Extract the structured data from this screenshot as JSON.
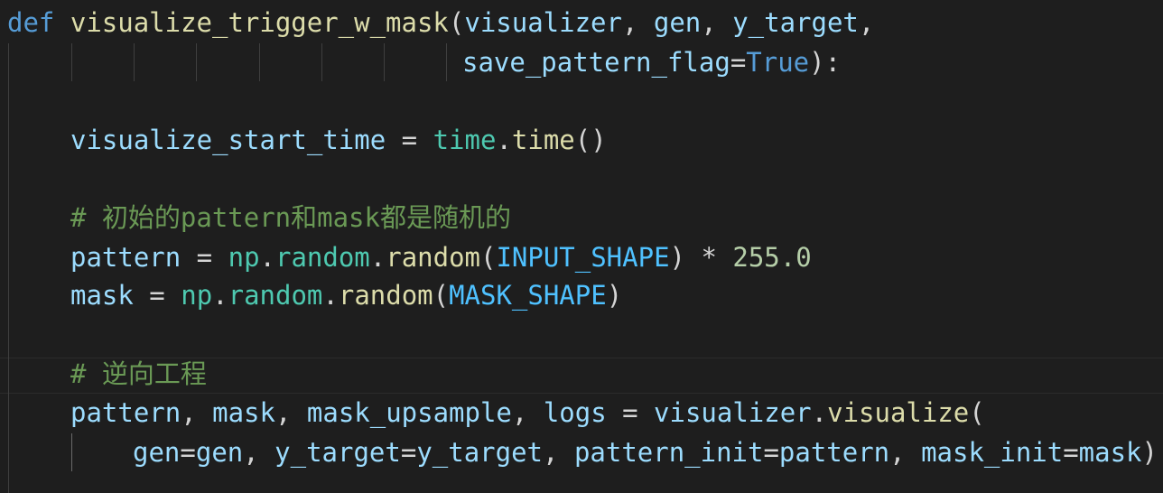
{
  "code": {
    "line1": {
      "kw_def": "def",
      "func_name": "visualize_trigger_w_mask",
      "open_paren": "(",
      "param1": "visualizer",
      "comma1": ", ",
      "param2": "gen",
      "comma2": ", ",
      "param3": "y_target",
      "comma3": ","
    },
    "line2": {
      "param4": "save_pattern_flag",
      "eq": "=",
      "true_val": "True",
      "close": "):"
    },
    "line3": {
      "var": "visualize_start_time",
      "eq": " = ",
      "module": "time",
      "dot": ".",
      "call": "time",
      "parens": "()"
    },
    "line4": {
      "comment": "# 初始的pattern和mask都是随机的"
    },
    "line5": {
      "var": "pattern",
      "eq": " = ",
      "mod1": "np",
      "dot1": ".",
      "mod2": "random",
      "dot2": ".",
      "call": "random",
      "open": "(",
      "const": "INPUT_SHAPE",
      "close": ")",
      "op": " * ",
      "num": "255.0"
    },
    "line6": {
      "var": "mask",
      "eq": " = ",
      "mod1": "np",
      "dot1": ".",
      "mod2": "random",
      "dot2": ".",
      "call": "random",
      "open": "(",
      "const": "MASK_SHAPE",
      "close": ")"
    },
    "line7": {
      "comment": "# 逆向工程"
    },
    "line8": {
      "v1": "pattern",
      "c1": ", ",
      "v2": "mask",
      "c2": ", ",
      "v3": "mask_upsample",
      "c3": ", ",
      "v4": "logs",
      "eq": " = ",
      "obj": "visualizer",
      "dot": ".",
      "call": "visualize",
      "open": "("
    },
    "line9": {
      "k1": "gen",
      "e1": "=",
      "v1": "gen",
      "c1": ", ",
      "k2": "y_target",
      "e2": "=",
      "v2": "y_target",
      "c2": ", ",
      "k3": "pattern_init",
      "e3": "=",
      "v3": "pattern",
      "c3": ", ",
      "k4": "mask_init",
      "e4": "=",
      "v4": "mask",
      "close": ")"
    }
  },
  "colors": {
    "background": "#1e1e1e",
    "keyword": "#569cd6",
    "function": "#dcdcaa",
    "variable": "#9cdcfe",
    "constant": "#4fc1ff",
    "module": "#4ec9b0",
    "number": "#b5cea8",
    "comment": "#6a9955",
    "punctuation": "#d4d4d4"
  }
}
